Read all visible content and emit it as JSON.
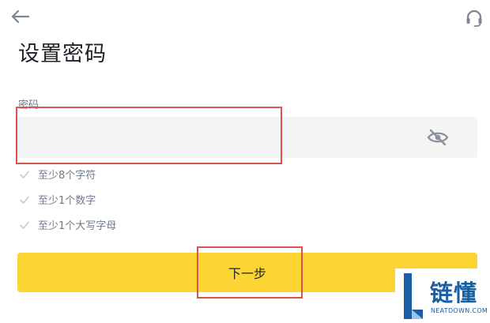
{
  "header": {
    "back_icon": "arrow-left-icon",
    "support_icon": "headset-icon"
  },
  "page": {
    "title": "设置密码"
  },
  "password": {
    "label": "密码",
    "value": "",
    "placeholder": "",
    "toggle_icon": "eye-off-icon"
  },
  "requirements": [
    {
      "text": "至少8个字符"
    },
    {
      "text": "至少1个数字"
    },
    {
      "text": "至少1个大写字母"
    }
  ],
  "actions": {
    "next_label": "下一步"
  },
  "watermark": {
    "cn": "链懂",
    "en": "NEATDOWN.COM"
  },
  "colors": {
    "accent": "#fcd535",
    "highlight": "#d9534f",
    "field_bg": "#f4f4f4",
    "muted_text": "#707a8a",
    "watermark": "#1a5fa3"
  }
}
